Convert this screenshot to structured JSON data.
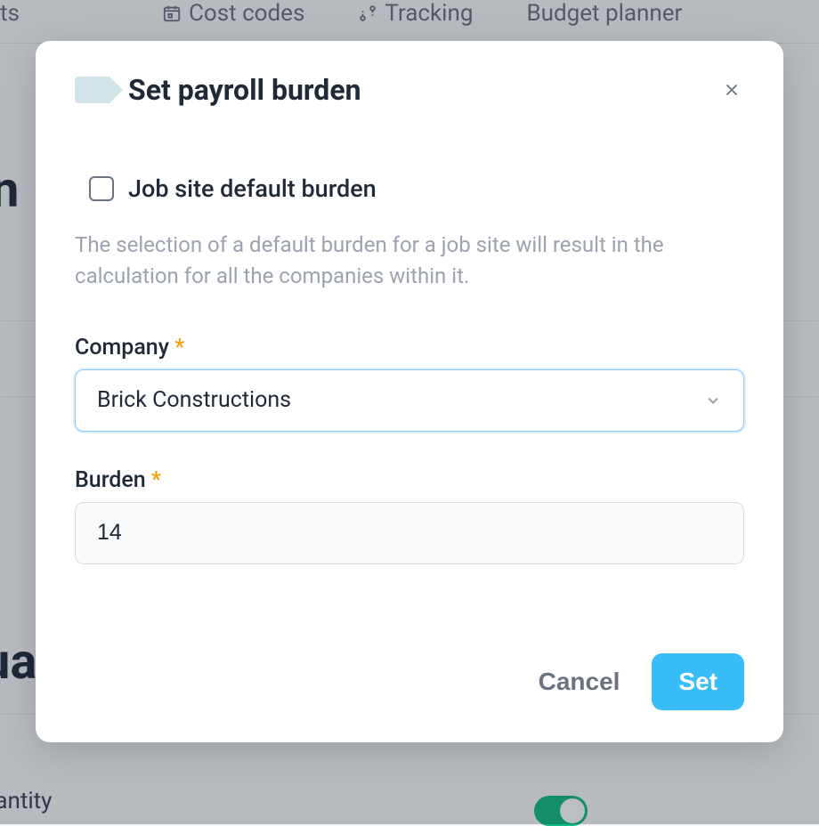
{
  "nav": {
    "item0_partial": "ts",
    "item1": "Cost codes",
    "item2": "Tracking",
    "item3": "Budget planner"
  },
  "bg": {
    "letter_n": "n",
    "letter_ua": "ua",
    "quantity": "uantity"
  },
  "modal": {
    "title": "Set payroll burden",
    "checkbox_label": "Job site default burden",
    "helper_text": "The selection of a default burden for a job site will result in the calculation for all the companies within it.",
    "company_label": "Company",
    "company_value": "Brick Constructions",
    "burden_label": "Burden",
    "burden_value": "14",
    "required_marker": "*",
    "cancel_label": "Cancel",
    "set_label": "Set"
  }
}
